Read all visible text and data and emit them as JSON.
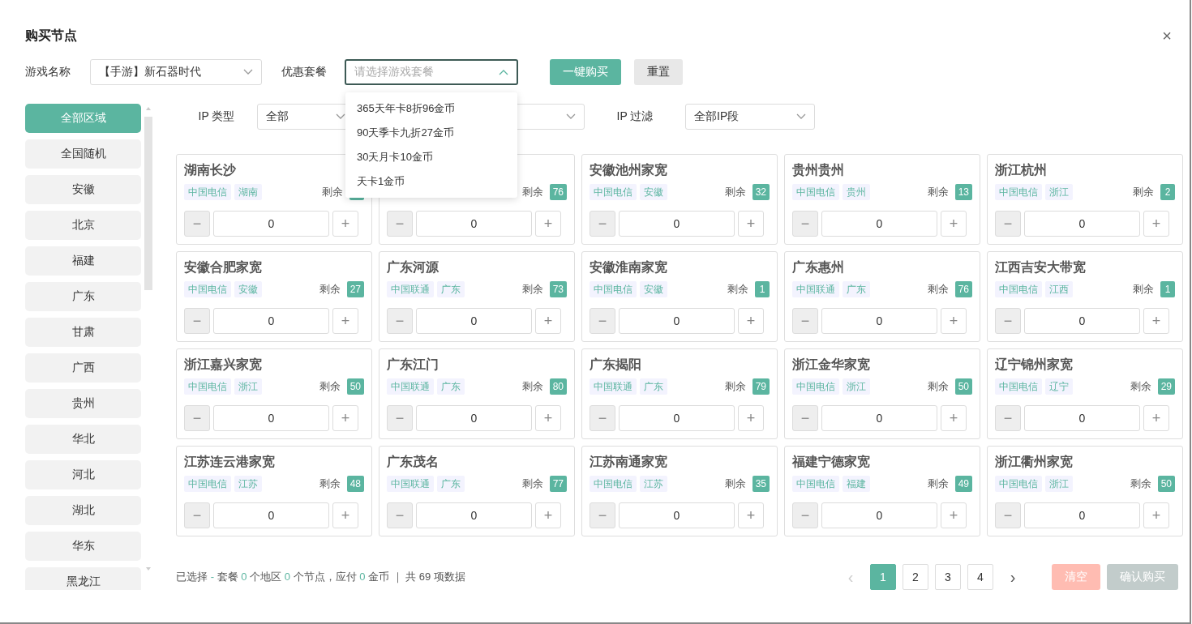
{
  "dialog": {
    "title": "购买节点",
    "close": "×"
  },
  "top_form": {
    "game_label": "游戏名称",
    "game_value": "【手游】新石器时代",
    "package_label": "优惠套餐",
    "package_placeholder": "请选择游戏套餐",
    "package_expanded": true,
    "package_options": [
      "365天年卡8折96金币",
      "90天季卡九折27金币",
      "30天月卡10金币",
      "天卡1金币"
    ],
    "buy_button": "一键购买",
    "reset_button": "重置"
  },
  "regions": [
    {
      "label": "全部区域",
      "selected": true
    },
    {
      "label": "全国随机",
      "selected": false
    },
    {
      "label": "安徽",
      "selected": false
    },
    {
      "label": "北京",
      "selected": false
    },
    {
      "label": "福建",
      "selected": false
    },
    {
      "label": "广东",
      "selected": false
    },
    {
      "label": "甘肃",
      "selected": false
    },
    {
      "label": "广西",
      "selected": false
    },
    {
      "label": "贵州",
      "selected": false
    },
    {
      "label": "华北",
      "selected": false
    },
    {
      "label": "河北",
      "selected": false
    },
    {
      "label": "湖北",
      "selected": false
    },
    {
      "label": "华东",
      "selected": false
    },
    {
      "label": "黑龙江",
      "selected": false
    }
  ],
  "filters": [
    {
      "kind": "labeled",
      "label": "IP 类型",
      "value": "全部"
    },
    {
      "kind": "covered"
    },
    {
      "kind": "labeled",
      "label": "IP 过滤",
      "value": "全部IP段"
    }
  ],
  "stepper": {
    "decrement": "−",
    "increment": "+",
    "decrement_disabled": true
  },
  "nodes": [
    {
      "name": "湖南长沙",
      "tags": [
        "中国电信",
        "湖南"
      ],
      "remaining_label": "剩余",
      "quantity": "0"
    },
    {
      "remaining_label": "剩余",
      "remaining": "76",
      "quantity": "0"
    },
    {
      "name": "安徽池州家宽",
      "tags": [
        "中国电信",
        "安徽"
      ],
      "remaining_label": "剩余",
      "remaining": "32",
      "quantity": "0"
    },
    {
      "name": "贵州贵州",
      "tags": [
        "中国电信",
        "贵州"
      ],
      "remaining_label": "剩余",
      "remaining": "13",
      "quantity": "0"
    },
    {
      "name": "浙江杭州",
      "tags": [
        "中国电信",
        "浙江"
      ],
      "remaining_label": "剩余",
      "remaining": "2",
      "quantity": "0"
    },
    {
      "name": "安徽合肥家宽",
      "tags": [
        "中国电信",
        "安徽"
      ],
      "remaining_label": "剩余",
      "remaining": "27",
      "quantity": "0"
    },
    {
      "name": "广东河源",
      "tags": [
        "中国联通",
        "广东"
      ],
      "remaining_label": "剩余",
      "remaining": "73",
      "quantity": "0"
    },
    {
      "name": "安徽淮南家宽",
      "tags": [
        "中国电信",
        "安徽"
      ],
      "remaining_label": "剩余",
      "remaining": "1",
      "quantity": "0"
    },
    {
      "name": "广东惠州",
      "tags": [
        "中国联通",
        "广东"
      ],
      "remaining_label": "剩余",
      "remaining": "76",
      "quantity": "0"
    },
    {
      "name": "江西吉安大带宽",
      "tags": [
        "中国电信",
        "江西"
      ],
      "remaining_label": "剩余",
      "remaining": "1",
      "quantity": "0"
    },
    {
      "name": "浙江嘉兴家宽",
      "tags": [
        "中国电信",
        "浙江"
      ],
      "remaining_label": "剩余",
      "remaining": "50",
      "quantity": "0"
    },
    {
      "name": "广东江门",
      "tags": [
        "中国联通",
        "广东"
      ],
      "remaining_label": "剩余",
      "remaining": "80",
      "quantity": "0"
    },
    {
      "name": "广东揭阳",
      "tags": [
        "中国联通",
        "广东"
      ],
      "remaining_label": "剩余",
      "remaining": "79",
      "quantity": "0"
    },
    {
      "name": "浙江金华家宽",
      "tags": [
        "中国电信",
        "浙江"
      ],
      "remaining_label": "剩余",
      "remaining": "50",
      "quantity": "0"
    },
    {
      "name": "辽宁锦州家宽",
      "tags": [
        "中国电信",
        "辽宁"
      ],
      "remaining_label": "剩余",
      "remaining": "29",
      "quantity": "0"
    },
    {
      "name": "江苏连云港家宽",
      "tags": [
        "中国电信",
        "江苏"
      ],
      "remaining_label": "剩余",
      "remaining": "48",
      "quantity": "0"
    },
    {
      "name": "广东茂名",
      "tags": [
        "中国联通",
        "广东"
      ],
      "remaining_label": "剩余",
      "remaining": "77",
      "quantity": "0"
    },
    {
      "name": "江苏南通家宽",
      "tags": [
        "中国电信",
        "江苏"
      ],
      "remaining_label": "剩余",
      "remaining": "35",
      "quantity": "0"
    },
    {
      "name": "福建宁德家宽",
      "tags": [
        "中国电信",
        "福建"
      ],
      "remaining_label": "剩余",
      "remaining": "49",
      "quantity": "0"
    },
    {
      "name": "浙江衢州家宽",
      "tags": [
        "中国电信",
        "浙江"
      ],
      "remaining_label": "剩余",
      "remaining": "50",
      "quantity": "0"
    }
  ],
  "summary": [
    {
      "text": "已选择 ",
      "highlight": false
    },
    {
      "text": "-",
      "highlight": true
    },
    {
      "text": " 套餐 ",
      "highlight": false
    },
    {
      "text": "0",
      "highlight": true
    },
    {
      "text": " 个地区 ",
      "highlight": false
    },
    {
      "text": "0",
      "highlight": true
    },
    {
      "text": " 个节点，应付 ",
      "highlight": false
    },
    {
      "text": "0",
      "highlight": true
    },
    {
      "text": " 金币 ｜ 共 69 项数据",
      "highlight": false
    }
  ],
  "pagination": {
    "prev": "‹",
    "prev_disabled": true,
    "pages": [
      {
        "label": "1",
        "selected": true
      },
      {
        "label": "2",
        "selected": false
      },
      {
        "label": "3",
        "selected": false
      },
      {
        "label": "4",
        "selected": false
      }
    ],
    "next": "›"
  },
  "actions": [
    {
      "label": "清空",
      "kind": "clear",
      "disabled": true
    },
    {
      "label": "确认购买",
      "kind": "confirm",
      "disabled": true
    }
  ]
}
